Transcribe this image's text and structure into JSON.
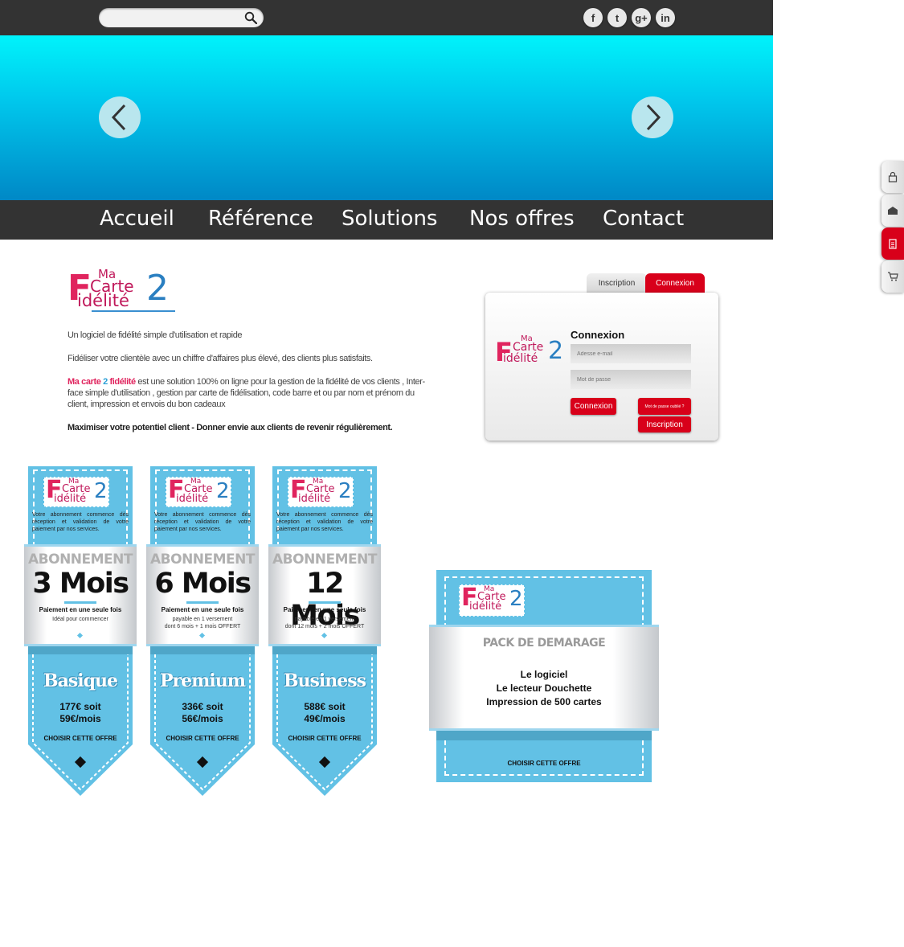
{
  "search": {
    "placeholder": ""
  },
  "social": [
    {
      "icon": "facebook-icon",
      "glyph": "f"
    },
    {
      "icon": "twitter-icon",
      "glyph": "t"
    },
    {
      "icon": "google-plus-icon",
      "glyph": "g+"
    },
    {
      "icon": "linkedin-icon",
      "glyph": "in"
    }
  ],
  "nav": {
    "items": [
      "Accueil",
      "Référence",
      "Solutions",
      "Nos offres",
      "Contact"
    ]
  },
  "brand": {
    "ma": "Ma",
    "carte": "Carte",
    "fidelite": "idélité",
    "f": "F",
    "two": "2"
  },
  "intro": {
    "line1": "Un logiciel de fidélité  simple d'utilisation et rapide",
    "line2": "Fidéliser votre clientèle avec un chiffre d'affaires plus élevé, des clients plus satisfaits.",
    "brand_a": "Ma carte",
    "brand_b": " 2 ",
    "brand_c": "fidélité",
    "line3": "  est une solution 100%  on ligne pour la gestion de  la fidélité de vos clients , Inter-face simple d'utilisation , gestion par  carte de fidélisation, code barre et ou par nom et prénom du client, impression et envois du bon cadeaux",
    "line4": "Maximiser votre potentiel client - Donner envie aux clients de revenir régulièrement."
  },
  "login": {
    "tab_inscription": "Inscription",
    "tab_connexion": "Connexion",
    "title": "Connexion",
    "email_placeholder": "Adesse e-mail",
    "password_placeholder": "Mot de passe",
    "connexion_button": "Connexion",
    "forgot_button": "Mot de passe oublié ?",
    "inscription_button": "Inscription"
  },
  "offers": [
    {
      "desc": "Votre abonnement commence dès réception et validation de votre paiement par nos services.",
      "abo": "ABONNEMENT",
      "duration": "3 Mois",
      "payment": "Paiement en une seule fois",
      "sub1": "Idéal pour commencer",
      "sub2": "",
      "plan": "Basique",
      "price1": "177€ soit",
      "price2": "59€/mois",
      "choose": "CHOISIR CETTE OFFRE"
    },
    {
      "desc": "Votre abonnement commence dès réception et validation de votre paiement par nos services.",
      "abo": "ABONNEMENT",
      "duration": "6 Mois",
      "payment": "Paiement en une seule fois",
      "sub1": "payable en 1 versement",
      "sub2": "dont 6 mois + 1 mois OFFERT",
      "plan": "Premium",
      "price1": "336€ soit",
      "price2": "56€/mois",
      "choose": "CHOISIR CETTE OFFRE"
    },
    {
      "desc": "Votre abonnement commence dès réception et validation de votre paiement par nos services.",
      "abo": "ABONNEMENT",
      "duration": "12 Mois",
      "payment": "Paiement en une seule fois",
      "sub1": "payable en 1 versement",
      "sub2": "dont 12 mois + 2 mois OFFERT",
      "plan": "Business",
      "price1": "588€ soit",
      "price2": "49€/mois",
      "choose": "CHOISIR CETTE OFFRE"
    }
  ],
  "pack": {
    "title": "PACK DE DEMARAGE",
    "line1": "Le logiciel",
    "line2": "Le lecteur Douchette",
    "line3": "Impression de 500 cartes",
    "choose": "CHOISIR CETTE OFFRE"
  },
  "sidetabs": [
    "lock-icon",
    "mail-icon",
    "document-icon",
    "cart-icon"
  ],
  "colors": {
    "topbar": "#333333",
    "accent_red": "#d8001a",
    "offer_blue": "#62c1e5",
    "brand_pink": "#e0245e",
    "brand_blue": "#2a7fc1"
  }
}
